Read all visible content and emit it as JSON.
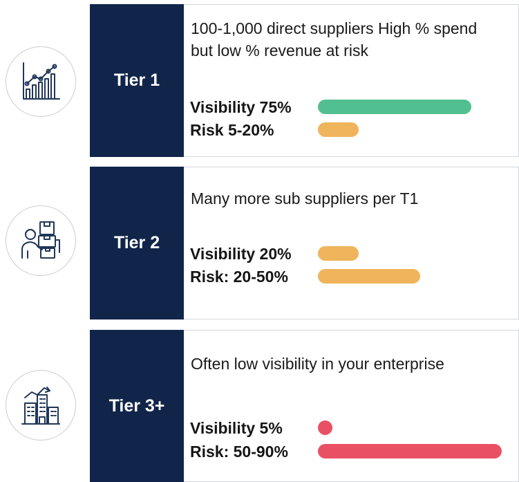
{
  "colors": {
    "navy": "#11254a",
    "green": "#52bf90",
    "orange": "#f0b45c",
    "red": "#ea5064",
    "icon_stroke": "#1f3658"
  },
  "tiers": [
    {
      "label": "Tier 1",
      "icon": "growth-chart-icon",
      "description": "100-1,000 direct suppliers High % spend but low % revenue at risk",
      "visibility": {
        "label": "Visibility 75%",
        "fraction": 0.75,
        "color": "green"
      },
      "risk": {
        "label": "Risk 5-20%",
        "fraction": 0.2,
        "color": "orange"
      }
    },
    {
      "label": "Tier 2",
      "icon": "supplier-worker-boxes-icon",
      "description": "Many more sub suppliers per T1",
      "visibility": {
        "label": "Visibility 20%",
        "fraction": 0.2,
        "color": "orange"
      },
      "risk": {
        "label": "Risk: 20-50%",
        "fraction": 0.5,
        "color": "orange"
      }
    },
    {
      "label": "Tier 3+",
      "icon": "enterprise-buildings-icon",
      "description": "Often low visibility in your enterprise",
      "visibility": {
        "label": "Visibility 5%",
        "fraction": 0.05,
        "color": "red"
      },
      "risk": {
        "label": "Risk: 50-90%",
        "fraction": 0.9,
        "color": "red"
      }
    }
  ]
}
